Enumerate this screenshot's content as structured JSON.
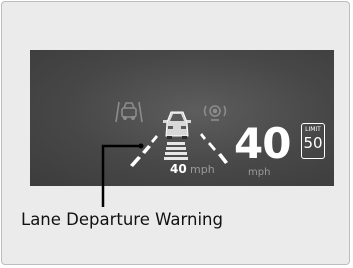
{
  "display": {
    "icons": [
      "lane-keeping-assist-icon",
      "adaptive-cruise-control-icon",
      "vehicle-ahead-icon"
    ],
    "small_speed": "40",
    "small_speed_unit": "mph",
    "big_speed": "40",
    "big_speed_unit": "mph",
    "speed_limit_label": "LIMIT",
    "speed_limit_value": "50"
  },
  "caption": "Lane Departure Warning",
  "colors": {
    "screen_bg": "#474747",
    "lane_marker": "#ffffff",
    "icon_dim": "#8c8c8c",
    "frame_bg": "#ebebeb"
  }
}
